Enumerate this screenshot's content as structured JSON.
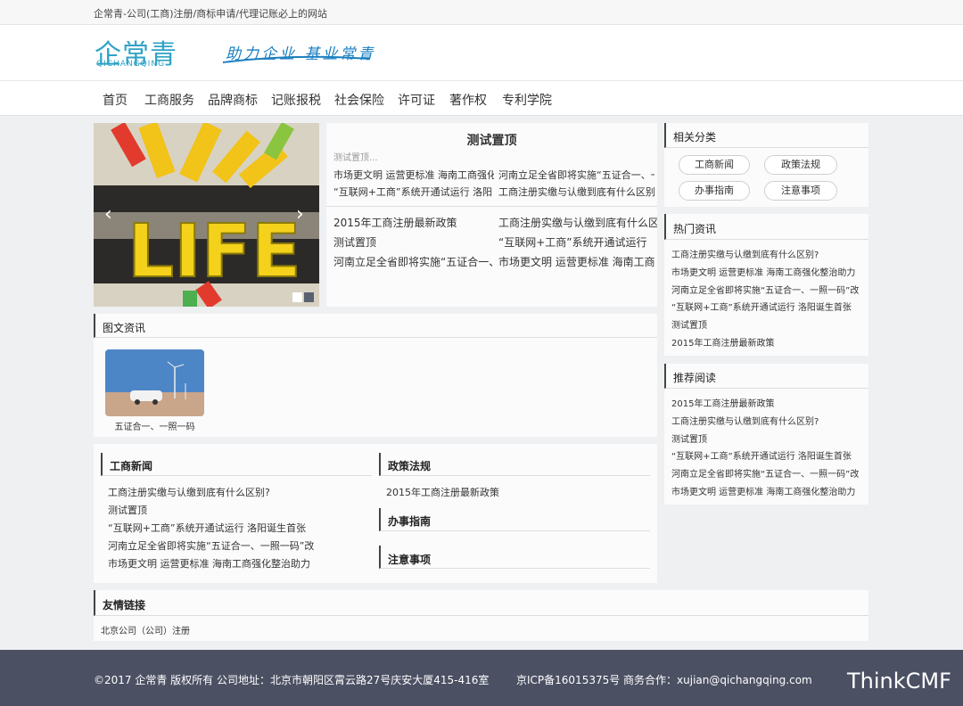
{
  "topbar": {
    "text": "企常青-公司(工商)注册/商标申请/代理记账必上的网站"
  },
  "header": {
    "logo_text": "企常青",
    "logo_sub": "QICHANGQING",
    "slogan": "助力企业 基业常青"
  },
  "nav": [
    "首页",
    "工商服务",
    "品牌商标",
    "记账报税",
    "社会保险",
    "许可证",
    "著作权",
    "专利学院"
  ],
  "slider": {
    "word": "LIFE"
  },
  "top_news": {
    "title": "测试置顶",
    "summary": "测试置顶...",
    "featured_left": [
      "市场更文明 运营更标准 海南工商强化",
      "“互联网+工商”系统开通试运行 洛阳"
    ],
    "featured_right": [
      "河南立足全省即将实施“五证合一、一照",
      "工商注册实缴与认缴到底有什么区别?"
    ],
    "list_left": [
      "2015年工商注册最新政策",
      "测试置顶",
      "河南立足全省即将实施“五证合一、"
    ],
    "list_right": [
      "工商注册实缴与认缴到底有什么区别",
      "“互联网+工商”系统开通试运行",
      "市场更文明 运营更标准 海南工商"
    ]
  },
  "photo_news": {
    "title": "图文资讯",
    "items": [
      {
        "caption": "五证合一、一照一码"
      }
    ]
  },
  "business_news": {
    "title": "工商新闻",
    "items": [
      "工商注册实缴与认缴到底有什么区别?",
      "测试置顶",
      "“互联网+工商”系统开通试运行 洛阳诞生首张",
      "河南立足全省即将实施“五证合一、一照一码”改",
      "市场更文明 运营更标准 海南工商强化整治助力"
    ]
  },
  "policy": {
    "title": "政策法规",
    "items": [
      "2015年工商注册最新政策"
    ]
  },
  "guide": {
    "title": "办事指南"
  },
  "notice": {
    "title": "注意事项"
  },
  "related": {
    "title": "相关分类",
    "tags": [
      "工商新闻",
      "政策法规",
      "办事指南",
      "注意事项"
    ]
  },
  "hot": {
    "title": "热门资讯",
    "items": [
      "工商注册实缴与认缴到底有什么区别?",
      "市场更文明 运营更标准 海南工商强化整治助力",
      "河南立足全省即将实施“五证合一、一照一码”改",
      "“互联网+工商”系统开通试运行 洛阳诞生首张",
      "测试置顶",
      "2015年工商注册最新政策"
    ]
  },
  "recommend": {
    "title": "推荐阅读",
    "items": [
      "2015年工商注册最新政策",
      "工商注册实缴与认缴到底有什么区别?",
      "测试置顶",
      "“互联网+工商”系统开通试运行 洛阳诞生首张",
      "河南立足全省即将实施“五证合一、一照一码”改",
      "市场更文明 运营更标准 海南工商强化整治助力"
    ]
  },
  "friend_links": {
    "title": "友情链接",
    "items": [
      "北京公司（公司）注册"
    ]
  },
  "footer": {
    "copyright": "©2017  企常青  版权所有  公司地址：北京市朝阳区霄云路27号庆安大厦415-416室",
    "icp": "京ICP备16015375号  商务合作：xujian@qichangqing.com",
    "brand": "ThinkCMF"
  },
  "colors": {
    "footer_bg": "#4b5063",
    "logo_blue": "#2fa3c6",
    "logo_green": "#6cb63a"
  }
}
